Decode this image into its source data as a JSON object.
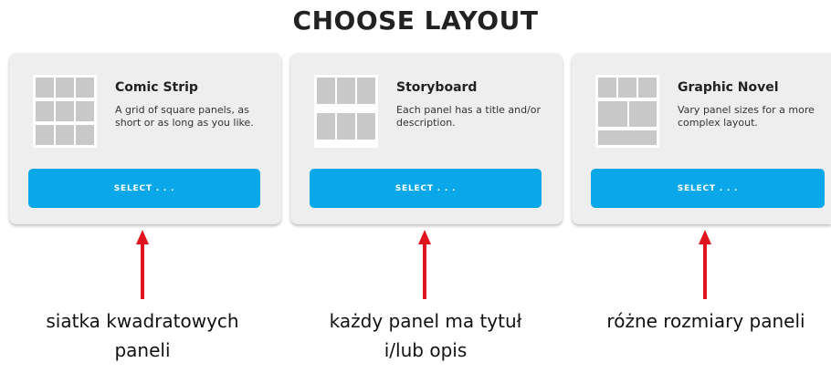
{
  "page": {
    "title": "CHOOSE LAYOUT"
  },
  "colors": {
    "select_button": "#0aa8e8",
    "card_background": "#eeeeee",
    "panel_thumbnail": "#c8c8c8",
    "arrow": "#e0141e"
  },
  "cards": [
    {
      "name": "Comic Strip",
      "description": "A grid of square panels, as short or as long as you like.",
      "button_label": "SELECT . . .",
      "thumbnail_icon": "comic-strip-grid-icon"
    },
    {
      "name": "Storyboard",
      "description": "Each panel has a title and/or description.",
      "button_label": "SELECT . . .",
      "thumbnail_icon": "storyboard-panels-icon"
    },
    {
      "name": "Graphic Novel",
      "description": "Vary panel sizes for a more complex layout.",
      "button_label": "SELECT . . .",
      "thumbnail_icon": "graphic-novel-layout-icon"
    }
  ],
  "annotations": [
    {
      "text": "siatka kwadratowych paneli"
    },
    {
      "text": "każdy panel ma tytuł i/lub opis"
    },
    {
      "text": "różne rozmiary paneli"
    }
  ]
}
